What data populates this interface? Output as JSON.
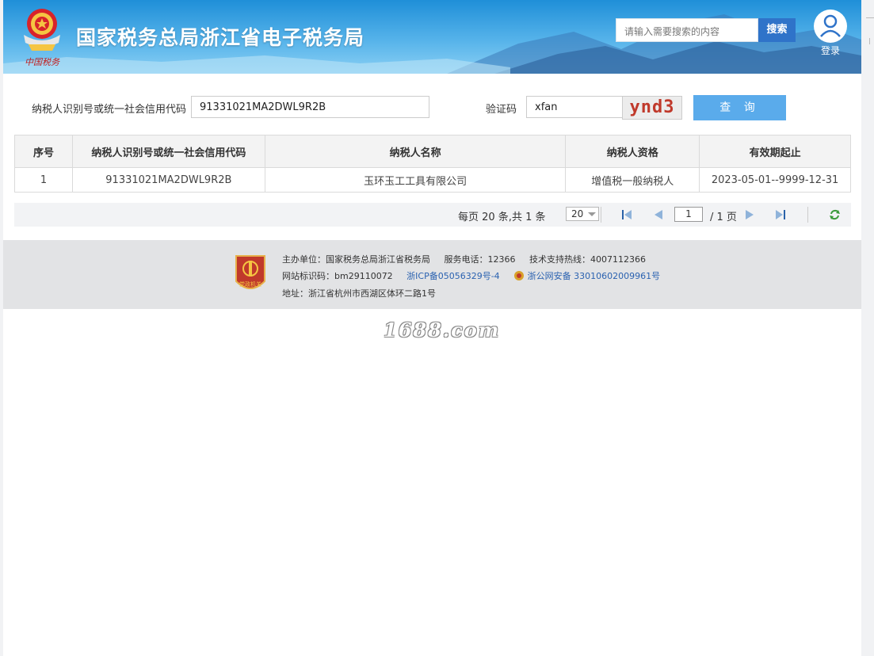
{
  "header": {
    "site_title": "国家税务总局浙江省电子税务局",
    "search_placeholder": "请输入需要搜索的内容",
    "search_button": "搜索",
    "login_label": "登录",
    "emblem_caption": "中国税务"
  },
  "form": {
    "taxpayer_id_label": "纳税人识别号或统一社会信用代码",
    "taxpayer_id_value": "91331021MA2DWL9R2B",
    "captcha_label": "验证码",
    "captcha_value": "xfan",
    "captcha_image_text": "ynd3",
    "query_button": "查 询"
  },
  "table": {
    "headers": [
      "序号",
      "纳税人识别号或统一社会信用代码",
      "纳税人名称",
      "纳税人资格",
      "有效期起止"
    ],
    "rows": [
      [
        "1",
        "91331021MA2DWL9R2B",
        "玉环玉工工具有限公司",
        "增值税一般纳税人",
        "2023-05-01--9999-12-31"
      ]
    ]
  },
  "pager": {
    "info": "每页 20 条,共 1 条",
    "page_size": "20",
    "current_page": "1",
    "total_pages": "/ 1 页"
  },
  "footer": {
    "host": "主办单位：国家税务总局浙江省税务局",
    "phone": "服务电话：12366",
    "hotline": "技术支持热线：4007112366",
    "site_id": "网站标识码：bm29110072",
    "icp": "浙ICP备05056329号-4",
    "police": "浙公网安备 33010602009961号",
    "address": "地址：浙江省杭州市西湖区体环二路1号",
    "badge_text": "党政机关"
  },
  "watermark": "1688.com",
  "colors": {
    "header_blue": "#1f8fd8",
    "button_blue": "#2f73c9",
    "query_blue": "#5aabeb",
    "captcha_red": "#c0392b",
    "link_blue": "#2b62b0"
  }
}
